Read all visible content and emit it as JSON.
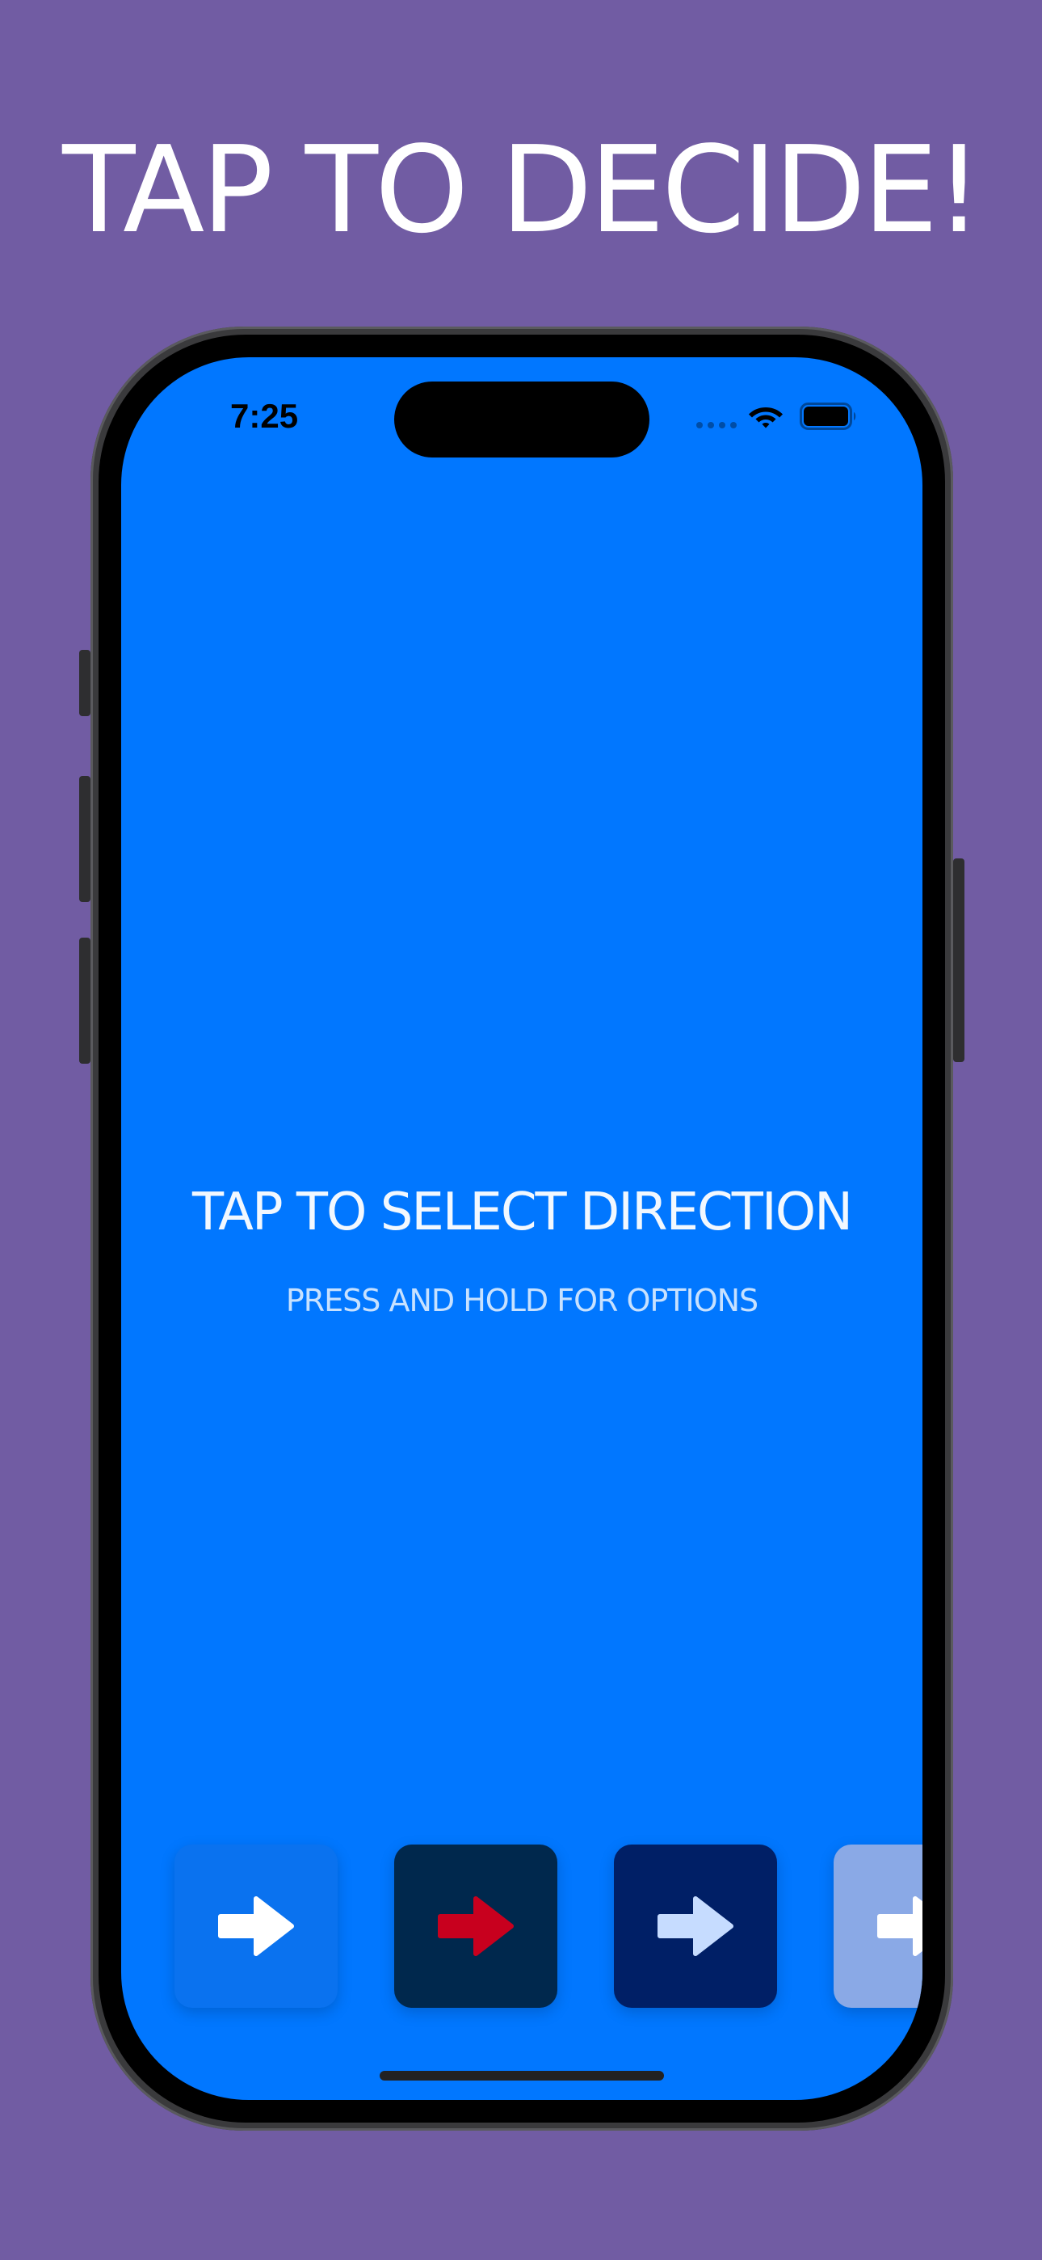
{
  "headline": "TAP TO DECIDE!",
  "status_bar": {
    "time": "7:25",
    "wifi_icon": "wifi-icon",
    "battery_icon": "battery-icon"
  },
  "main": {
    "prompt": "TAP TO SELECT DIRECTION",
    "subprompt": "PRESS AND HOLD FOR OPTIONS"
  },
  "options": [
    {
      "icon": "arrow-right-icon",
      "tile_color": "#0a72ef",
      "arrow_color": "#ffffff"
    },
    {
      "icon": "arrow-right-icon",
      "tile_color": "#00284d",
      "arrow_color": "#c8001e"
    },
    {
      "icon": "arrow-right-icon",
      "tile_color": "#001f66",
      "arrow_color": "#c6dcff"
    },
    {
      "icon": "arrow-right-icon",
      "tile_color": "#8aa9e6",
      "arrow_color": "#ffffff"
    }
  ],
  "colors": {
    "background": "#715ca3",
    "screen": "#0177ff"
  }
}
